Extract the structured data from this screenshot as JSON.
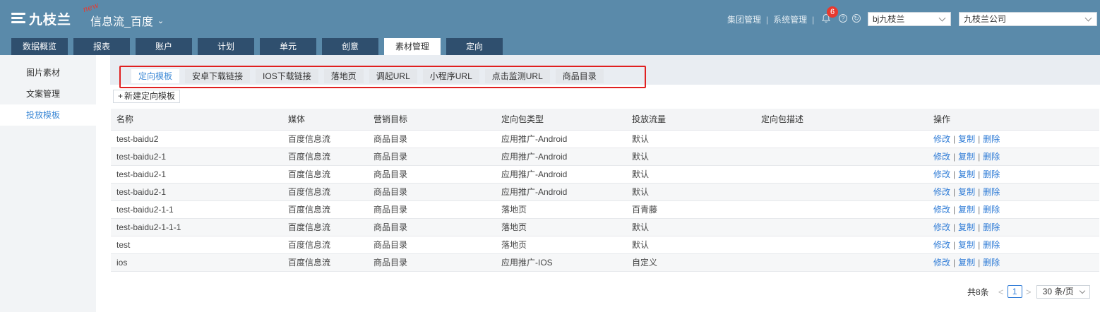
{
  "header": {
    "logo_text": "九枝兰",
    "new_badge": "new",
    "app_title": "信息流_百度",
    "links": [
      "集团管理",
      "系统管理"
    ],
    "link_sep": "|",
    "notification_count": "6",
    "user_select": "bj九枝兰",
    "company_select": "九枝兰公司",
    "colors": {
      "header_bg": "#5a8aaa",
      "tab_bg": "#2f4f6e",
      "badge": "#e8392e"
    }
  },
  "main_tabs": [
    {
      "label": "数据概览"
    },
    {
      "label": "报表"
    },
    {
      "label": "账户"
    },
    {
      "label": "计划"
    },
    {
      "label": "单元"
    },
    {
      "label": "创意"
    },
    {
      "label": "素材管理",
      "active": true
    },
    {
      "label": "定向"
    }
  ],
  "sidebar": {
    "items": [
      {
        "label": "图片素材"
      },
      {
        "label": "文案管理"
      },
      {
        "label": "投放模板",
        "active": true
      }
    ]
  },
  "sub_tabs": [
    {
      "label": "定向模板",
      "active": true
    },
    {
      "label": "安卓下载链接"
    },
    {
      "label": "IOS下载链接"
    },
    {
      "label": "落地页"
    },
    {
      "label": "调起URL"
    },
    {
      "label": "小程序URL"
    },
    {
      "label": "点击监测URL"
    },
    {
      "label": "商品目录"
    }
  ],
  "toolbar": {
    "new_label": "新建定向模板",
    "plus": "+"
  },
  "table": {
    "headers": [
      "名称",
      "媒体",
      "营销目标",
      "定向包类型",
      "投放流量",
      "定向包描述",
      "操作"
    ],
    "rows": [
      {
        "name": "test-baidu2",
        "media": "百度信息流",
        "goal": "商品目录",
        "type": "应用推广-Android",
        "traffic": "默认",
        "desc": ""
      },
      {
        "name": "test-baidu2-1",
        "media": "百度信息流",
        "goal": "商品目录",
        "type": "应用推广-Android",
        "traffic": "默认",
        "desc": ""
      },
      {
        "name": "test-baidu2-1",
        "media": "百度信息流",
        "goal": "商品目录",
        "type": "应用推广-Android",
        "traffic": "默认",
        "desc": ""
      },
      {
        "name": "test-baidu2-1",
        "media": "百度信息流",
        "goal": "商品目录",
        "type": "应用推广-Android",
        "traffic": "默认",
        "desc": ""
      },
      {
        "name": "test-baidu2-1-1",
        "media": "百度信息流",
        "goal": "商品目录",
        "type": "落地页",
        "traffic": "百青藤",
        "desc": ""
      },
      {
        "name": "test-baidu2-1-1-1",
        "media": "百度信息流",
        "goal": "商品目录",
        "type": "落地页",
        "traffic": "默认",
        "desc": ""
      },
      {
        "name": "test",
        "media": "百度信息流",
        "goal": "商品目录",
        "type": "落地页",
        "traffic": "默认",
        "desc": ""
      },
      {
        "name": "ios",
        "media": "百度信息流",
        "goal": "商品目录",
        "type": "应用推广-IOS",
        "traffic": "自定义",
        "desc": ""
      }
    ],
    "actions": {
      "edit": "修改",
      "copy": "复制",
      "delete": "删除",
      "sep": "|"
    }
  },
  "pagination": {
    "total": "共8条",
    "prev": "<",
    "current_page": "1",
    "next": ">",
    "page_size": "30 条/页"
  }
}
